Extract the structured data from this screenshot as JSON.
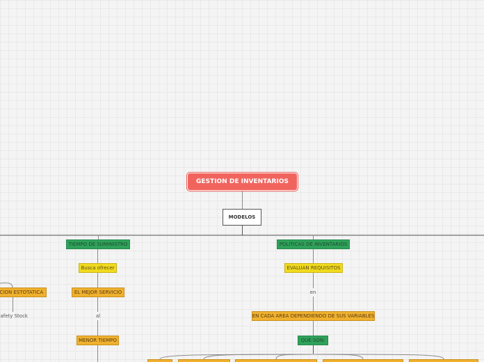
{
  "colors": {
    "root_fill": "#f1645e",
    "green_fill": "#2fa15a",
    "yellow_fill": "#f0da1e",
    "orange_fill": "#efb02e",
    "line": "#8a8a8a"
  },
  "nodes": {
    "root": "GESTION DE INVENTARIOS",
    "modelos": "MODELOS",
    "tiempo_suministro": "TIEMPO DE SUMINISTRO",
    "politicas": "POLITICAS DE INVENTARIOS",
    "busca_ofrecer": "Busca ofrecer",
    "evaluan_requisitos": "EVALUAN REQUISITOS",
    "estatica": "ACION ESTOTATICA",
    "mejor_servicio": "EL MEJOR SERVICIO",
    "en": "en",
    "safety_stock": "Safety Stock",
    "al": "al",
    "cada_area": "EN CADA AREA DEPENDIENDO DE SUS VARIABLES",
    "menor_tiempo": "MENOR TIEMPO",
    "que_son": "QUE SON:"
  }
}
